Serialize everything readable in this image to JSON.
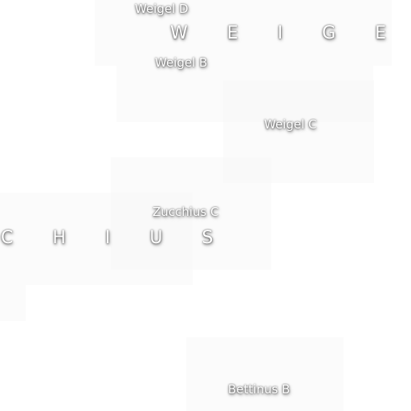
{
  "map": {
    "background_color": "#ffffff",
    "label_color": "#ffffff",
    "major_labels": {
      "weigel": "W E I G E L",
      "zucchius": "C H I U S"
    },
    "minor_labels": {
      "weigel_d": "Weigel D",
      "weigel_b": "Weigel B",
      "weigel_c": "Weigel C",
      "zucchius_c": "Zucchius C",
      "bettinus_b": "Bettinus B"
    }
  }
}
